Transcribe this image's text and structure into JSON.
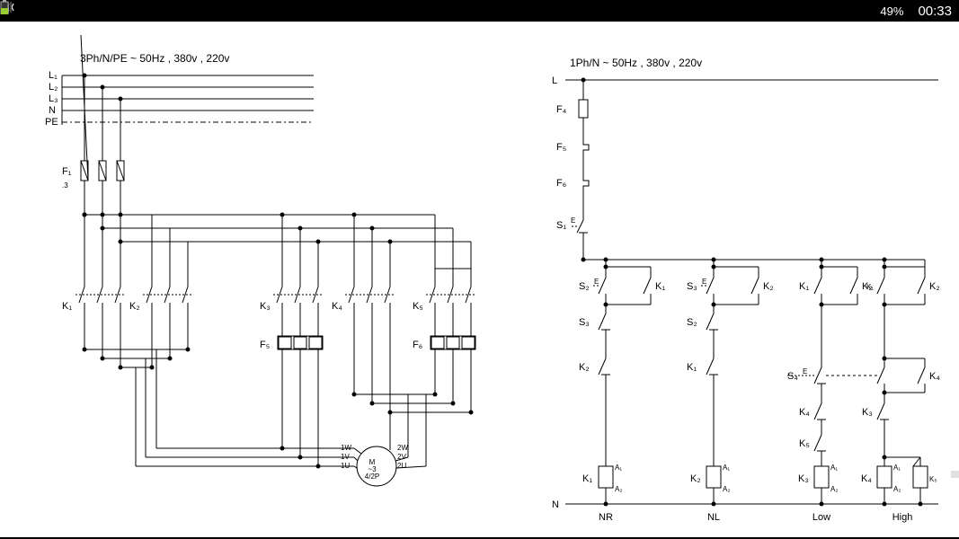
{
  "statusbar": {
    "battery_pct": "49%",
    "time": "00:33",
    "mute_icon": "mute-icon",
    "signal_icon": "signal-icon",
    "battery_icon": "battery-icon"
  },
  "power": {
    "title": "3Ph/N/PE ~ 50Hz , 380v , 220v",
    "lines": [
      "L₁",
      "L₂",
      "L₃",
      "N",
      "PE"
    ],
    "fuse": "F₁",
    "fuse_count": ".3",
    "contactors": [
      "K₁",
      "K₂",
      "K₃",
      "K₄",
      "K₅"
    ],
    "overloads": [
      "F₅",
      "F₆"
    ],
    "motor": {
      "label": "M",
      "sub1": "~3",
      "sub2": "4/2P",
      "t": [
        "1W",
        "1V",
        "1U",
        "2W",
        "2V",
        "2U"
      ]
    }
  },
  "control": {
    "title": "1Ph/N ~ 50Hz , 380v , 220v",
    "line": "L",
    "fuse": "F₄",
    "ol1": "F₅",
    "ol2": "F₆",
    "stop": "S₁",
    "s1sym": "E",
    "s2": "S₂",
    "s2sym": "E",
    "s3": "S₃",
    "s3sym": "E",
    "s4": "S₄",
    "s4sym": "E",
    "branches": {
      "nr": {
        "lbl": "NR",
        "s3": "S₃",
        "k2": "K₂",
        "coil": "K₁",
        "a1": "A₁",
        "a2": "A₂"
      },
      "nl": {
        "lbl": "NL",
        "k1": "K₁",
        "k2": "K₂",
        "s2": "S₂",
        "k1b": "K₁",
        "coil": "K₂",
        "a1": "A₁",
        "a2": "A₂"
      },
      "low": {
        "lbl": "Low",
        "k1": "K₁",
        "k2": "K₂",
        "k4": "K₄",
        "k5": "K₅",
        "coil": "K₃",
        "a1": "A₁",
        "a2": "A₂"
      },
      "high": {
        "lbl": "High",
        "k1": "K₁",
        "k2": "K₂",
        "k4": "K₄",
        "k3": "K₃",
        "coil1": "K₄",
        "coil2": "K₅",
        "a1": "A₁",
        "a2": "A₂"
      }
    },
    "neutral": "N"
  }
}
